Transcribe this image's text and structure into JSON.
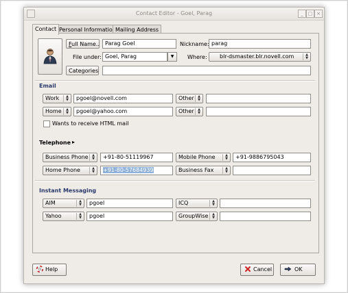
{
  "window": {
    "title": "Contact Editor - Goel, Parag",
    "controls": {
      "minimize": "_",
      "maximize": "□",
      "close": "×"
    }
  },
  "tabs": [
    {
      "label": "Contact",
      "active": true
    },
    {
      "label": "Personal Information",
      "active": false
    },
    {
      "label": "Mailing Address",
      "active": false
    }
  ],
  "identity": {
    "full_name_button": "Full Name...",
    "full_name_value": "Parag Goel",
    "nickname_label": "Nickname:",
    "nickname_value": "parag",
    "file_under_label": "File under:",
    "file_under_value": "Goel, Parag",
    "where_label": "Where:",
    "where_value": "blr-dsmaster.blr.novell.com",
    "categories_button": "Categories",
    "categories_value": ""
  },
  "email": {
    "heading": "Email",
    "rows": [
      {
        "type": "Work",
        "value": "pgoel@novell.com",
        "type2": "Other",
        "value2": ""
      },
      {
        "type": "Home",
        "value": "pgoel@yahoo.com",
        "type2": "Other",
        "value2": ""
      }
    ],
    "html_mail_label": "Wants to receive HTML mail",
    "html_mail_checked": false
  },
  "telephone": {
    "heading": "Telephone",
    "expander": "▸",
    "rows": [
      {
        "type": "Business Phone",
        "value": "+91-80-51119967",
        "type2": "Mobile Phone",
        "value2": "+91-9886795043"
      },
      {
        "type": "Home Phone",
        "value": "+91-80-57684939",
        "type2": "Business Fax",
        "value2": ""
      }
    ]
  },
  "im": {
    "heading": "Instant Messaging",
    "rows": [
      {
        "service": "AIM",
        "value": "pgoel",
        "service2": "ICQ",
        "value2": ""
      },
      {
        "service": "Yahoo",
        "value": "pgoel",
        "service2": "GroupWise",
        "value2": ""
      }
    ]
  },
  "buttons": {
    "help": "Help",
    "cancel": "Cancel",
    "ok": "OK"
  },
  "icons": {
    "contact_photo": "person-icon",
    "help": "lifebuoy-icon",
    "cancel": "cancel-x-icon",
    "ok": "ok-hand-icon"
  },
  "colors": {
    "section_heading": "#2a3a6a",
    "selection": "#8fb0d8",
    "window_bg": "#efebe7"
  }
}
